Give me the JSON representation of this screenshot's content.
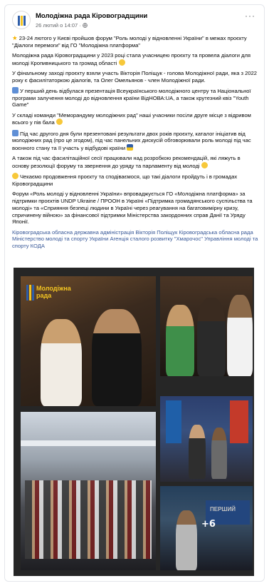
{
  "header": {
    "page_name": "Молодіжна рада Кіровоградщини",
    "meta": "26 лютий о 14:07 · ",
    "more": "···"
  },
  "post": {
    "paragraphs": [
      "23-24 лютого у Києві пройшов форум \"Роль молоді у відновленні України\" в межах проєкту \"Діалоги перемоги\" від ГО \"Молодіжна платформа\"",
      "Молодіжна рада Кіровоградщини у 2023 році стала учасницею проєкту та провела діалоги для молоді Кропивницького та громад області",
      "У фінальному заході проєкту взяли участь Вікторія Поліщук - голова Молодіжної ради, яка з 2022 року є фасилітаторкою діалогів, та Олег Омельянов - член Молодіжної ради.",
      "У перший день відбулася презентація Всеукраїнського молодіжного центру та Національної програми залучення молоді до відновлення країни ВідНОВА:UA, а також крутезний квіз \"Youth Game\"",
      "У складі команди \"Меморандуму молодіжних рад\" наші учасники посіли друге місце з відривом всього у пів бала",
      "Під час другого дня були презентовані результати двох років проєкту, каталог ініціатив від молодіжних рад (про це згодом), під час панельних дискусій обговорювали роль молоді під час воєнного стану та її участь у відбудові країни",
      "А також під час фасилітаційної сесії працювали над розробкою рекомендацій, які ляжуть в основу резолюції форуму та звернення до уряду та парламенту від молоді",
      "Чекаємо продовження проєкту та сподіваємося, що такі діалоги пройдуть і в громадах Кіровоградщини",
      "Форум «Роль молоді у відновленні України» впроваджується ГО «Молодіжна платформа» за підтримки проєктів UNDP Ukraine / ПРООН в Україні «Підтримка громадянського суспільства та молоді» та «Сприяння безпеці людини в Україні через реагування на багатовимірну кризу, спричинену війною» за фінансової підтримки Міністерства закордонних справ Данії та Уряду Японії."
    ],
    "hashtags": "Кіровоградська обласна державна адміністрація Вікторія Поліщук Кіровоградська обласна рада Міністерство молоді та спорту України Агенція сталого розвитку \"Хмарочос\" Управління молоді та спорту КОДА"
  },
  "gallery": {
    "logo_text_line1": "Молодіжна",
    "logo_text_line2": "рада",
    "more_count": "+6",
    "banner_text": "ПЕРШИЙ"
  },
  "colors": {
    "link": "#385898",
    "meta": "#65676b",
    "brand_yellow": "#f3c422",
    "brand_blue": "#2f5ea8"
  }
}
